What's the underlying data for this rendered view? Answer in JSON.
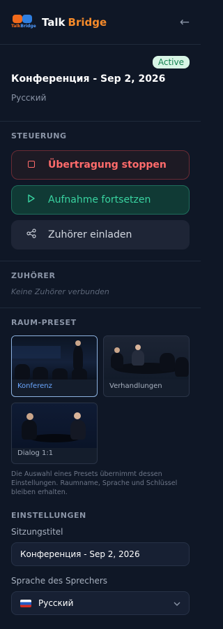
{
  "header": {
    "logo_text_a": "Talk",
    "logo_text_b": "Bridge",
    "brand_a": "Talk",
    "brand_b": "Bridge",
    "back_icon": "←"
  },
  "session": {
    "status": "Active",
    "title": "Конференция - Sep 2, 2026",
    "language": "Русский"
  },
  "controls": {
    "label": "STEUERUNG",
    "stop": "Übertragung stoppen",
    "resume": "Aufnahme fortsetzen",
    "invite": "Zuhörer einladen"
  },
  "listeners": {
    "label": "ZUHÖRER",
    "empty": "Keine Zuhörer verbunden"
  },
  "presets": {
    "label": "RAUM-PRESET",
    "items": [
      {
        "name": "Konferenz",
        "active": true
      },
      {
        "name": "Verhandlungen",
        "active": false
      },
      {
        "name": "Dialog 1:1",
        "active": false
      }
    ],
    "note": "Die Auswahl eines Presets übernimmt dessen Einstellungen. Raumname, Sprache und Schlüssel bleiben erhalten."
  },
  "settings": {
    "label": "EINSTELLUNGEN",
    "title_label": "Sitzungstitel",
    "title_value": "Конференция - Sep 2, 2026",
    "lang_label": "Sprache des Sprechers",
    "lang_value": "Русский"
  },
  "colors": {
    "background": "#0f1726",
    "accent_orange": "#f58a2a",
    "stop_red": "#ff6b6b",
    "resume_green": "#39d3a0",
    "active_badge": "#d8f5e6"
  }
}
